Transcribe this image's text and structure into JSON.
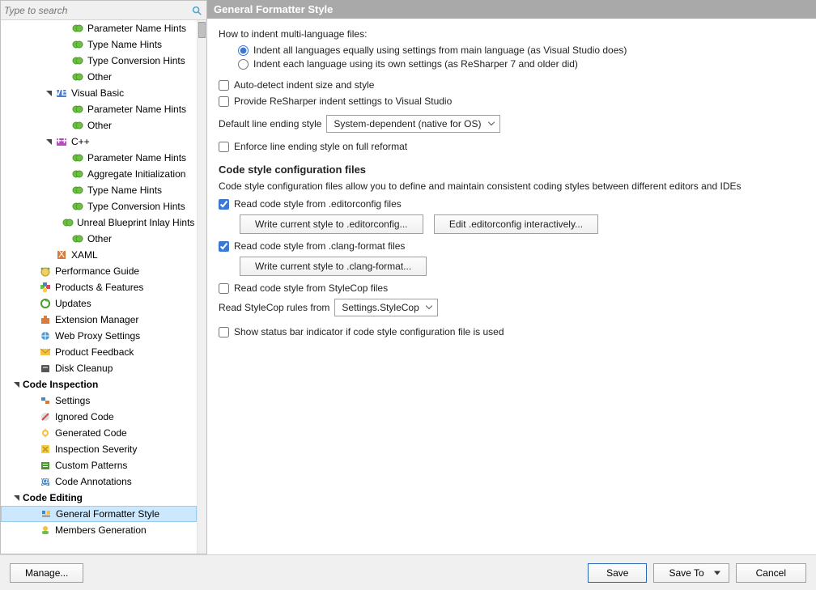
{
  "search": {
    "placeholder": "Type to search"
  },
  "tree": [
    {
      "ind": 4,
      "icon": "hint",
      "label": "Parameter Name Hints"
    },
    {
      "ind": 4,
      "icon": "hint",
      "label": "Type Name Hints"
    },
    {
      "ind": 4,
      "icon": "hint",
      "label": "Type Conversion Hints"
    },
    {
      "ind": 4,
      "icon": "hint",
      "label": "Other"
    },
    {
      "ind": 3,
      "icon": "vb",
      "label": "Visual Basic",
      "exp": true
    },
    {
      "ind": 4,
      "icon": "hint",
      "label": "Parameter Name Hints"
    },
    {
      "ind": 4,
      "icon": "hint",
      "label": "Other"
    },
    {
      "ind": 3,
      "icon": "cpp",
      "label": "C++",
      "exp": true
    },
    {
      "ind": 4,
      "icon": "hint",
      "label": "Parameter Name Hints"
    },
    {
      "ind": 4,
      "icon": "hint",
      "label": "Aggregate Initialization"
    },
    {
      "ind": 4,
      "icon": "hint",
      "label": "Type Name Hints"
    },
    {
      "ind": 4,
      "icon": "hint",
      "label": "Type Conversion Hints"
    },
    {
      "ind": 4,
      "icon": "hint",
      "label": "Unreal Blueprint Inlay Hints"
    },
    {
      "ind": 4,
      "icon": "hint",
      "label": "Other"
    },
    {
      "ind": 3,
      "icon": "xaml",
      "label": "XAML"
    },
    {
      "ind": 2,
      "icon": "perf",
      "label": "Performance Guide"
    },
    {
      "ind": 2,
      "icon": "prod",
      "label": "Products & Features"
    },
    {
      "ind": 2,
      "icon": "updates",
      "label": "Updates"
    },
    {
      "ind": 2,
      "icon": "ext",
      "label": "Extension Manager"
    },
    {
      "ind": 2,
      "icon": "proxy",
      "label": "Web Proxy Settings"
    },
    {
      "ind": 2,
      "icon": "feedback",
      "label": "Product Feedback"
    },
    {
      "ind": 2,
      "icon": "disk",
      "label": "Disk Cleanup"
    },
    {
      "ind": 1,
      "icon": "none",
      "label": "Code Inspection",
      "exp": true,
      "bold": true
    },
    {
      "ind": 2,
      "icon": "settings",
      "label": "Settings"
    },
    {
      "ind": 2,
      "icon": "ignored",
      "label": "Ignored Code"
    },
    {
      "ind": 2,
      "icon": "gen",
      "label": "Generated Code"
    },
    {
      "ind": 2,
      "icon": "severity",
      "label": "Inspection Severity"
    },
    {
      "ind": 2,
      "icon": "pattern",
      "label": "Custom Patterns"
    },
    {
      "ind": 2,
      "icon": "annot",
      "label": "Code Annotations"
    },
    {
      "ind": 1,
      "icon": "none",
      "label": "Code Editing",
      "exp": true,
      "bold": true
    },
    {
      "ind": 2,
      "icon": "gfs",
      "label": "General Formatter Style",
      "selected": true
    },
    {
      "ind": 2,
      "icon": "members",
      "label": "Members Generation"
    }
  ],
  "title": "General Formatter Style",
  "howto": "How to indent multi-language files:",
  "opt1": "Indent all languages equally using settings from main language (as Visual Studio does)",
  "opt2": "Indent each language using its own settings (as ReSharper 7 and older did)",
  "chk_autodetect": "Auto-detect indent size and style",
  "chk_provide": "Provide ReSharper indent settings to Visual Studio",
  "def_ending_label": "Default line ending style",
  "def_ending_value": "System-dependent (native for OS)",
  "chk_enforce": "Enforce line ending style on full reformat",
  "section_code_style": "Code style configuration files",
  "code_style_desc": "Code style configuration files allow you to define and maintain consistent coding styles between different editors and IDEs",
  "chk_editorconfig": "Read code style from .editorconfig files",
  "btn_write_editor": "Write current style to .editorconfig...",
  "btn_edit_editor": "Edit .editorconfig interactively...",
  "chk_clang": "Read code style from .clang-format files",
  "btn_write_clang": "Write current style to .clang-format...",
  "chk_stylecop": "Read code style from StyleCop files",
  "stylecop_label": "Read StyleCop rules from",
  "stylecop_value": "Settings.StyleCop",
  "chk_status": "Show status bar indicator if code style configuration file is used",
  "footer": {
    "manage": "Manage...",
    "save": "Save",
    "saveto": "Save To",
    "cancel": "Cancel"
  }
}
